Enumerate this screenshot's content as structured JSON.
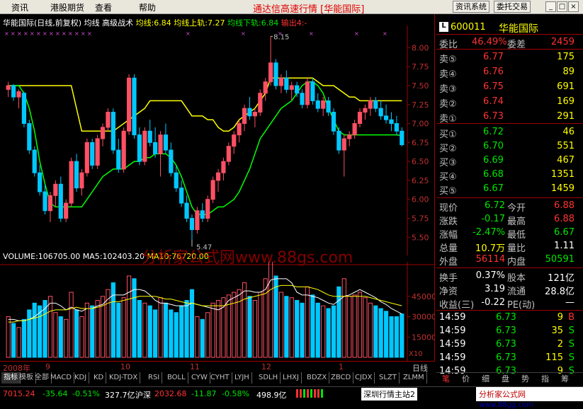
{
  "menu": {
    "items": [
      "资讯",
      "港股期货",
      "查看",
      "帮助"
    ],
    "title": "通达信高速行情 [华能国际]",
    "buttons": [
      "资讯系统",
      "委托交易"
    ],
    "window_controls": [
      "_",
      "□",
      "×"
    ]
  },
  "chart_header": {
    "stock": "华能国际(日线,前复权)",
    "indicators": [
      "均线",
      "高级战术"
    ],
    "lines": [
      {
        "label": "均线:6.84",
        "color": "#ffff00"
      },
      {
        "label": "均线上轨:7.27",
        "color": "#ffff00"
      },
      {
        "label": "均线下轨:6.84",
        "color": "#00ff00"
      },
      {
        "label": "输出4:-",
        "color": "#ff3232"
      }
    ]
  },
  "price_axis": [
    "8.00",
    "7.75",
    "7.50",
    "7.25",
    "7.00",
    "6.75",
    "6.50",
    "6.25",
    "6.00",
    "5.75",
    "5.50"
  ],
  "price_markers": [
    {
      "label": "8.15"
    },
    {
      "label": "5.47"
    }
  ],
  "volume_header": {
    "vol": "VOLUME:106705.00",
    "ma5": "MA5:102403.20",
    "ma10": "MA10:76720.00"
  },
  "volume_axis": [
    "45000",
    "30000",
    "15000"
  ],
  "volume_unit": "X10",
  "watermark": "分析家公式网www.88gs.com",
  "date_axis": {
    "labels": [
      "2008年",
      "9",
      "10",
      "11",
      "12",
      "1"
    ],
    "period": "日线"
  },
  "bottom_tabs": [
    "指标",
    "模板",
    "全部",
    "MACD",
    "KDJ",
    "KD",
    "KDJ-TDX",
    "RSI",
    "BOLL",
    "CYW",
    "CYHT",
    "LYJH",
    "SDLH",
    "LHXJ",
    "BDZX",
    "ZBCD",
    "CJDX",
    "SLZT",
    "ZLMM"
  ],
  "quote": {
    "code": "600011",
    "name": "华能国际",
    "commission_ratio": {
      "label": "委比",
      "value": "46.49%",
      "diff_label": "委差",
      "diff": "2459"
    },
    "sell": [
      {
        "label": "卖⑤",
        "price": "6.77",
        "vol": "175"
      },
      {
        "label": "卖④",
        "price": "6.76",
        "vol": "89"
      },
      {
        "label": "卖③",
        "price": "6.75",
        "vol": "691"
      },
      {
        "label": "卖②",
        "price": "6.74",
        "vol": "169"
      },
      {
        "label": "卖①",
        "price": "6.73",
        "vol": "291"
      }
    ],
    "buy": [
      {
        "label": "买①",
        "price": "6.72",
        "vol": "46"
      },
      {
        "label": "买②",
        "price": "6.70",
        "vol": "551"
      },
      {
        "label": "买③",
        "price": "6.69",
        "vol": "467"
      },
      {
        "label": "买④",
        "price": "6.68",
        "vol": "1351"
      },
      {
        "label": "买⑤",
        "price": "6.67",
        "vol": "1459"
      }
    ],
    "stats": [
      {
        "l1": "现价",
        "v1": "6.72",
        "l2": "今开",
        "v2": "6.88"
      },
      {
        "l1": "涨跌",
        "v1": "-0.17",
        "l2": "最高",
        "v2": "6.88"
      },
      {
        "l1": "涨幅",
        "v1": "-2.47%",
        "l2": "最低",
        "v2": "6.67"
      },
      {
        "l1": "总量",
        "v1": "10.7万",
        "l2": "量比",
        "v2": "1.11"
      },
      {
        "l1": "外盘",
        "v1": "56114",
        "l2": "内盘",
        "v2": "50591"
      }
    ],
    "fundamentals": [
      {
        "l1": "换手",
        "v1": "0.37%",
        "l2": "股本",
        "v2": "121亿"
      },
      {
        "l1": "净资",
        "v1": "3.19",
        "l2": "流通",
        "v2": "28.8亿"
      },
      {
        "l1": "收益(三)",
        "v1": "-0.22",
        "l2": "PE(动)",
        "v2": "—"
      }
    ],
    "ticks": [
      {
        "time": "14:59",
        "price": "6.73",
        "vol": "9",
        "side": "B"
      },
      {
        "time": "14:59",
        "price": "6.73",
        "vol": "35",
        "side": "S"
      },
      {
        "time": "14:59",
        "price": "6.73",
        "vol": "2",
        "side": "S"
      },
      {
        "time": "14:59",
        "price": "6.73",
        "vol": "115",
        "side": "S"
      },
      {
        "time": "14:59",
        "price": "6.73",
        "vol": "9",
        "side": "S"
      }
    ],
    "tabs": [
      "笔",
      "价",
      "细",
      "盘",
      "势",
      "指",
      "筹"
    ]
  },
  "status": {
    "sh_index": "7015.24",
    "sh_change": "-35.64",
    "sh_pct": "-0.51%",
    "sh_amount": "327.7亿",
    "sz_label": "沪深",
    "sz_index": "2032.68",
    "sz_change": "-11.87",
    "sz_pct": "-0.58%",
    "sz_amount": "498.9亿",
    "server": "深圳行情主站2",
    "site": "分析家公式网",
    "site_url": "www.88gg.com"
  },
  "chart_data": {
    "type": "candlestick",
    "ylim": [
      5.4,
      8.2
    ],
    "candles": [
      [
        7.45,
        7.55,
        7.35,
        7.5
      ],
      [
        7.5,
        7.52,
        7.3,
        7.35
      ],
      [
        7.35,
        7.45,
        7.2,
        7.42
      ],
      [
        7.4,
        7.42,
        6.95,
        7.0
      ],
      [
        7.0,
        7.05,
        6.6,
        6.65
      ],
      [
        6.65,
        6.7,
        6.3,
        6.35
      ],
      [
        6.35,
        6.45,
        6.05,
        6.1
      ],
      [
        6.1,
        6.2,
        5.8,
        5.85
      ],
      [
        5.85,
        6.1,
        5.7,
        6.05
      ],
      [
        6.05,
        6.25,
        5.9,
        6.2
      ],
      [
        6.2,
        6.3,
        5.7,
        5.75
      ],
      [
        5.75,
        6.0,
        5.7,
        5.95
      ],
      [
        5.95,
        6.55,
        5.9,
        6.5
      ],
      [
        6.5,
        6.6,
        6.1,
        6.15
      ],
      [
        6.15,
        6.4,
        6.05,
        6.35
      ],
      [
        6.35,
        6.8,
        6.3,
        6.75
      ],
      [
        6.75,
        6.8,
        6.4,
        6.45
      ],
      [
        6.45,
        6.85,
        6.4,
        6.8
      ],
      [
        6.8,
        7.0,
        6.7,
        6.95
      ],
      [
        6.95,
        7.2,
        6.9,
        7.15
      ],
      [
        7.15,
        7.2,
        6.6,
        6.65
      ],
      [
        6.65,
        6.8,
        6.35,
        6.4
      ],
      [
        6.4,
        6.95,
        6.35,
        6.9
      ],
      [
        6.9,
        7.65,
        6.85,
        7.6
      ],
      [
        7.6,
        7.65,
        6.8,
        6.85
      ],
      [
        6.85,
        6.95,
        6.45,
        6.5
      ],
      [
        6.5,
        6.95,
        6.45,
        6.9
      ],
      [
        6.9,
        7.05,
        6.7,
        6.75
      ],
      [
        6.75,
        6.95,
        6.55,
        6.6
      ],
      [
        6.6,
        6.9,
        6.3,
        6.85
      ],
      [
        6.85,
        7.0,
        6.6,
        6.65
      ],
      [
        6.65,
        6.75,
        6.3,
        6.35
      ],
      [
        6.35,
        6.45,
        6.1,
        6.15
      ],
      [
        6.15,
        6.25,
        5.9,
        5.95
      ],
      [
        5.95,
        6.05,
        5.7,
        5.75
      ],
      [
        5.75,
        5.8,
        5.47,
        5.6
      ],
      [
        5.6,
        5.9,
        5.55,
        5.85
      ],
      [
        5.85,
        5.95,
        5.7,
        5.75
      ],
      [
        5.75,
        6.05,
        5.7,
        6.0
      ],
      [
        6.0,
        6.3,
        5.95,
        6.25
      ],
      [
        6.25,
        6.4,
        6.1,
        6.35
      ],
      [
        6.35,
        6.55,
        6.25,
        6.5
      ],
      [
        6.5,
        6.75,
        6.45,
        6.7
      ],
      [
        6.7,
        6.9,
        6.6,
        6.85
      ],
      [
        6.85,
        7.05,
        6.75,
        7.0
      ],
      [
        7.0,
        7.25,
        6.9,
        7.2
      ],
      [
        7.2,
        7.35,
        7.05,
        7.1
      ],
      [
        7.1,
        7.2,
        6.95,
        7.15
      ],
      [
        7.15,
        7.45,
        7.1,
        7.4
      ],
      [
        7.4,
        7.6,
        7.3,
        7.55
      ],
      [
        7.55,
        8.15,
        7.5,
        7.8
      ],
      [
        7.8,
        7.85,
        7.45,
        7.5
      ],
      [
        7.5,
        7.65,
        7.4,
        7.6
      ],
      [
        7.6,
        7.7,
        7.4,
        7.45
      ],
      [
        7.45,
        7.55,
        7.3,
        7.5
      ],
      [
        7.5,
        7.55,
        7.35,
        7.4
      ],
      [
        7.4,
        7.45,
        7.2,
        7.25
      ],
      [
        7.25,
        7.6,
        7.2,
        7.55
      ],
      [
        7.55,
        7.6,
        7.25,
        7.3
      ],
      [
        7.3,
        7.4,
        7.15,
        7.2
      ],
      [
        7.2,
        7.35,
        7.1,
        7.3
      ],
      [
        7.3,
        7.35,
        7.1,
        7.15
      ],
      [
        7.15,
        7.2,
        6.85,
        6.9
      ],
      [
        6.9,
        6.95,
        6.6,
        6.65
      ],
      [
        6.65,
        6.85,
        6.3,
        6.8
      ],
      [
        6.8,
        6.9,
        6.7,
        6.85
      ],
      [
        6.85,
        7.05,
        6.8,
        7.0
      ],
      [
        7.0,
        7.2,
        6.95,
        7.15
      ],
      [
        7.15,
        7.25,
        7.05,
        7.2
      ],
      [
        7.2,
        7.35,
        7.1,
        7.3
      ],
      [
        7.3,
        7.35,
        7.15,
        7.2
      ],
      [
        7.2,
        7.3,
        7.05,
        7.1
      ],
      [
        7.1,
        7.25,
        7.0,
        7.05
      ],
      [
        7.05,
        7.15,
        6.9,
        7.0
      ],
      [
        7.0,
        7.1,
        6.85,
        6.9
      ],
      [
        6.9,
        6.95,
        6.7,
        6.72
      ]
    ],
    "upper_band": [
      7.5,
      7.5,
      7.5,
      7.5,
      7.5,
      7.5,
      7.5,
      7.5,
      7.5,
      7.5,
      7.5,
      7.5,
      7.5,
      7.2,
      6.9,
      6.9,
      6.9,
      6.9,
      6.9,
      6.9,
      6.9,
      6.95,
      7.0,
      7.05,
      7.1,
      7.15,
      7.2,
      7.3,
      7.3,
      7.3,
      7.3,
      7.3,
      7.3,
      7.3,
      7.2,
      7.1,
      7.1,
      7.1,
      7.05,
      7.05,
      6.95,
      6.9,
      6.9,
      6.95,
      7.05,
      7.1,
      7.15,
      7.2,
      7.3,
      7.4,
      7.6,
      7.6,
      7.6,
      7.6,
      7.6,
      7.6,
      7.6,
      7.6,
      7.6,
      7.55,
      7.5,
      7.5,
      7.5,
      7.45,
      7.4,
      7.35,
      7.35,
      7.3,
      7.3,
      7.3,
      7.3,
      7.3,
      7.3,
      7.3,
      7.3,
      7.3
    ],
    "lower_band": [
      7.5,
      7.5,
      7.5,
      7.4,
      7.2,
      6.9,
      6.5,
      6.2,
      5.95,
      5.9,
      5.9,
      5.9,
      5.9,
      5.9,
      5.9,
      6.0,
      6.1,
      6.2,
      6.3,
      6.35,
      6.4,
      6.4,
      6.4,
      6.45,
      6.5,
      6.5,
      6.55,
      6.55,
      6.6,
      6.6,
      6.6,
      6.55,
      6.45,
      6.3,
      6.1,
      5.9,
      5.8,
      5.8,
      5.8,
      5.85,
      5.9,
      5.9,
      5.95,
      6.0,
      6.1,
      6.25,
      6.4,
      6.6,
      6.8,
      6.9,
      7.0,
      7.1,
      7.2,
      7.25,
      7.3,
      7.4,
      7.5,
      7.55,
      7.55,
      7.5,
      7.4,
      7.2,
      7.05,
      6.9,
      6.85,
      6.85,
      6.85,
      6.85,
      6.85,
      6.85,
      6.85,
      6.85,
      6.85,
      6.85,
      6.85,
      6.84
    ],
    "volume": [
      30,
      25,
      22,
      28,
      35,
      40,
      38,
      42,
      45,
      33,
      30,
      28,
      48,
      35,
      30,
      40,
      38,
      42,
      45,
      50,
      55,
      40,
      44,
      60,
      58,
      42,
      40,
      38,
      35,
      44,
      40,
      35,
      33,
      38,
      42,
      50,
      30,
      28,
      33,
      40,
      42,
      44,
      46,
      48,
      50,
      55,
      45,
      42,
      48,
      58,
      80,
      60,
      48,
      45,
      44,
      42,
      40,
      52,
      46,
      40,
      38,
      36,
      38,
      52,
      58,
      45,
      46,
      48,
      44,
      40,
      38,
      36,
      34,
      30,
      30,
      32
    ],
    "vol_ma5": [
      28,
      28,
      27,
      27,
      28,
      30,
      33,
      36,
      40,
      40,
      38,
      35,
      37,
      35,
      34,
      36,
      36,
      38,
      39,
      43,
      46,
      46,
      46,
      48,
      50,
      50,
      49,
      46,
      42,
      40,
      40,
      39,
      38,
      38,
      38,
      40,
      39,
      38,
      37,
      36,
      35,
      37,
      42,
      44,
      46,
      49,
      49,
      48,
      48,
      50,
      57,
      58,
      58,
      58,
      55,
      48,
      46,
      46,
      45,
      44,
      42,
      40,
      39,
      42,
      45,
      46,
      48,
      50,
      48,
      46,
      44,
      41,
      39,
      36,
      34,
      32
    ],
    "vol_ma10": [
      26,
      26,
      27,
      27,
      28,
      29,
      30,
      32,
      34,
      35,
      35,
      35,
      36,
      37,
      36,
      36,
      36,
      37,
      38,
      40,
      41,
      41,
      42,
      43,
      44,
      45,
      45,
      45,
      45,
      44,
      43,
      43,
      42,
      41,
      40,
      40,
      39,
      38,
      38,
      38,
      38,
      38,
      39,
      40,
      41,
      43,
      44,
      45,
      46,
      47,
      50,
      52,
      53,
      53,
      53,
      52,
      52,
      52,
      51,
      50,
      48,
      46,
      45,
      45,
      45,
      45,
      45,
      45,
      45,
      44,
      43,
      42,
      41,
      40,
      39,
      38
    ],
    "price_ticks": [
      8.0,
      7.75,
      7.5,
      7.25,
      7.0,
      6.75,
      6.5,
      6.25,
      6.0,
      5.75,
      5.5
    ],
    "volume_ticks": [
      45000,
      30000,
      15000
    ],
    "vol_max": 60000
  }
}
